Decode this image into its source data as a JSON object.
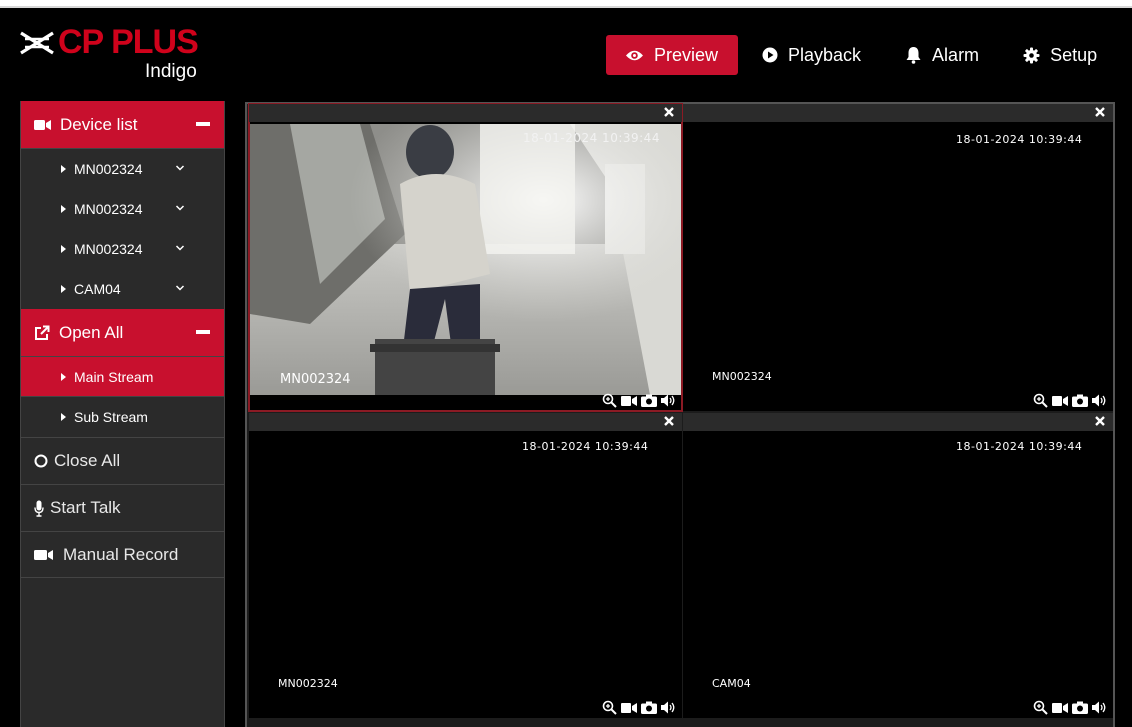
{
  "brand": {
    "name": "CP PLUS",
    "sub": "Indigo",
    "accent": "#c8102e"
  },
  "nav": {
    "preview": "Preview",
    "playback": "Playback",
    "alarm": "Alarm",
    "setup": "Setup",
    "active": "Preview"
  },
  "sidebar": {
    "device_list": "Device list",
    "devices": [
      "MN002324",
      "MN002324",
      "MN002324",
      "CAM04"
    ],
    "open_all": "Open All",
    "streams": [
      "Main Stream",
      "Sub Stream"
    ],
    "close_all": "Close All",
    "start_talk": "Start Talk",
    "manual_record": "Manual Record"
  },
  "panes": [
    {
      "name": "MN002324",
      "timestamp": "18-01-2024 10:39:44",
      "live": true
    },
    {
      "name": "MN002324",
      "timestamp": "18-01-2024 10:39:44",
      "live": false
    },
    {
      "name": "MN002324",
      "timestamp": "18-01-2024 10:39:44",
      "live": false
    },
    {
      "name": "CAM04",
      "timestamp": "18-01-2024 10:39:44",
      "live": false
    }
  ]
}
